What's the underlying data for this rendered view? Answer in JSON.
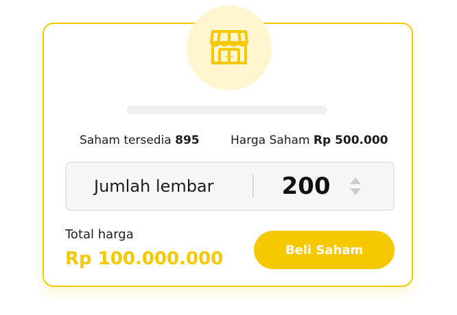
{
  "icon": {
    "name": "shop-icon",
    "accent_color": "#f6c800"
  },
  "progress": {
    "fraction": 0
  },
  "stock": {
    "available_label": "Saham tersedia",
    "available_value": "895",
    "price_label": "Harga Saham",
    "price_value": "Rp 500.000"
  },
  "quantity": {
    "label": "Jumlah lembar",
    "value": "200",
    "stepper_icon": "stepper-arrows-icon"
  },
  "total": {
    "label": "Total harga",
    "value": "Rp 100.000.000"
  },
  "actions": {
    "buy_label": "Beli Saham"
  },
  "colors": {
    "accent": "#f6c800",
    "icon_background": "#fff5cf",
    "field_background": "#f7f7f7"
  }
}
